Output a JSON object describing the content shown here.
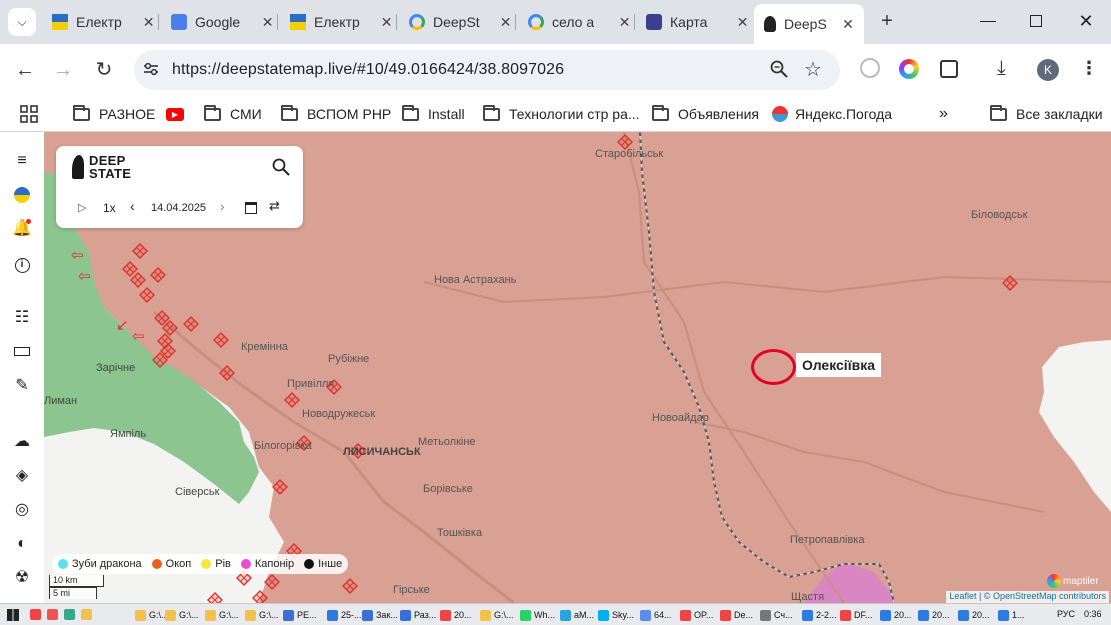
{
  "browser": {
    "tabs": [
      {
        "title": "Електр",
        "icon": "ukraine-flag-icon"
      },
      {
        "title": "Google",
        "icon": "google-translate-icon"
      },
      {
        "title": "Електр",
        "icon": "ukraine-flag-icon"
      },
      {
        "title": "DeepSt",
        "icon": "google-icon"
      },
      {
        "title": "село а",
        "icon": "google-icon"
      },
      {
        "title": "Карта",
        "icon": "map-app-icon"
      },
      {
        "title": "DeepS",
        "icon": "deepstate-icon",
        "active": true
      }
    ],
    "url": "https://deepstatemap.live/#10/49.0166424/38.8097026",
    "profile_initial": "K",
    "bookmarks": [
      {
        "label": "РАЗНОЕ",
        "icon": "folder-icon"
      },
      {
        "label": "",
        "icon": "youtube-icon"
      },
      {
        "label": "СМИ",
        "icon": "folder-icon"
      },
      {
        "label": "ВСПОМ РНР",
        "icon": "folder-icon"
      },
      {
        "label": "Install",
        "icon": "folder-icon"
      },
      {
        "label": "Технологии стр ра...",
        "icon": "folder-icon"
      },
      {
        "label": "Объявления",
        "icon": "folder-icon"
      },
      {
        "label": "Яндекс.Погода",
        "icon": "yandex-weather-icon"
      }
    ],
    "all_bookmarks_label": "Все закладки"
  },
  "app": {
    "logo_line1": "DEEP",
    "logo_line2": "STATE",
    "speed": "1x",
    "date": "14.04.2025",
    "legend": [
      {
        "label": "Зуби дракона",
        "color": "#5ce0f0"
      },
      {
        "label": "Окоп",
        "color": "#e8621a"
      },
      {
        "label": "Рів",
        "color": "#f6e83a"
      },
      {
        "label": "Капонір",
        "color": "#e84fd0"
      },
      {
        "label": "Інше",
        "color": "#111111"
      }
    ],
    "scale_km": "10 km",
    "scale_mi": "5 mi",
    "attribution_leaflet": "Leaflet",
    "attribution_rest": "| © OpenStreetMap contributors",
    "maptiler": "maptiler"
  },
  "map": {
    "highlight_label": "Олексіївка",
    "colors": {
      "occupied": "#d8a193",
      "ukraine": "#f2f2f2",
      "forest": "#7fbf86",
      "marker": "#e0312a",
      "circle": "#e0002a"
    },
    "places": [
      {
        "name": "Старобільськ"
      },
      {
        "name": "Біловодськ"
      },
      {
        "name": "Нова Астрахань"
      },
      {
        "name": "Кремінна"
      },
      {
        "name": "Рубіжне"
      },
      {
        "name": "Зарічне"
      },
      {
        "name": "Привілля"
      },
      {
        "name": "Новодружеськ"
      },
      {
        "name": "Новоайдар"
      },
      {
        "name": "Ямпіль"
      },
      {
        "name": "Білогорівка"
      },
      {
        "name": "ЛИСИЧАНСЬК"
      },
      {
        "name": "Метьолкіне"
      },
      {
        "name": "Борівське"
      },
      {
        "name": "Сіверськ"
      },
      {
        "name": "Тошківка"
      },
      {
        "name": "Петропавлівка"
      },
      {
        "name": "Гірське"
      },
      {
        "name": "Щастя"
      },
      {
        "name": "Лиман"
      }
    ]
  },
  "taskbar": {
    "items": [
      "G:\\...",
      "G:\\...",
      "G:\\...",
      "G:\\...",
      "PE...",
      "25-...",
      "Зак...",
      "Раз...",
      "20...",
      "G:\\...",
      "Wh...",
      "aM...",
      "Sky...",
      "64...",
      "OP...",
      "De...",
      "Сч...",
      "2-2...",
      "DF...",
      "20...",
      "20...",
      "20...",
      "1..."
    ],
    "lang": "РУС",
    "time": "0:36"
  }
}
